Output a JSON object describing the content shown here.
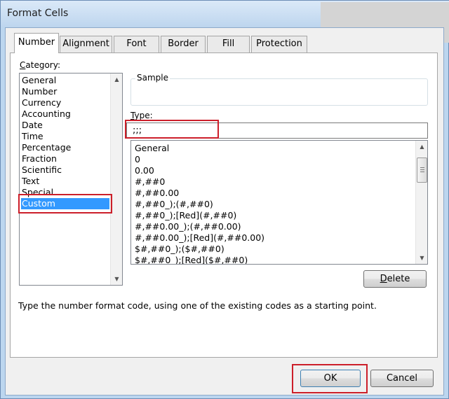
{
  "window": {
    "title": "Format Cells"
  },
  "tabs": [
    {
      "label": "Number",
      "active": true
    },
    {
      "label": "Alignment",
      "active": false
    },
    {
      "label": "Font",
      "active": false
    },
    {
      "label": "Border",
      "active": false
    },
    {
      "label": "Fill",
      "active": false
    },
    {
      "label": "Protection",
      "active": false
    }
  ],
  "category": {
    "label": "Category:",
    "items": [
      "General",
      "Number",
      "Currency",
      "Accounting",
      "Date",
      "Time",
      "Percentage",
      "Fraction",
      "Scientific",
      "Text",
      "Special",
      "Custom"
    ],
    "selected": "Custom"
  },
  "sample": {
    "label": "Sample",
    "value": ""
  },
  "type": {
    "label": "Type:",
    "value": ";;;",
    "formats": [
      "General",
      "0",
      "0.00",
      "#,##0",
      "#,##0.00",
      "#,##0_);(#,##0)",
      "#,##0_);[Red](#,##0)",
      "#,##0.00_);(#,##0.00)",
      "#,##0.00_);[Red](#,##0.00)",
      "$#,##0_);($#,##0)",
      "$#,##0_);[Red]($#,##0)"
    ]
  },
  "buttons": {
    "delete": "Delete",
    "ok": "OK",
    "cancel": "Cancel"
  },
  "description": "Type the number format code, using one of the existing codes as a starting point.",
  "colors": {
    "selection": "#3399ff",
    "highlight_box": "#cc1f2a",
    "window_frame": "#bcd6ef"
  }
}
